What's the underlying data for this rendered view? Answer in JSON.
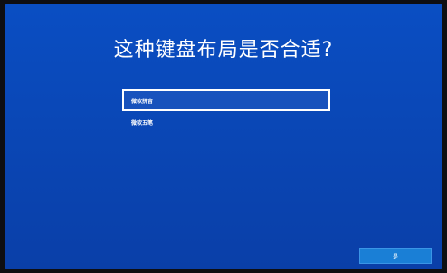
{
  "page": {
    "title": "这种键盘布局是否合适?"
  },
  "layouts": {
    "items": [
      {
        "label": "微软拼音",
        "selected": true
      },
      {
        "label": "微软五笔",
        "selected": false
      }
    ]
  },
  "footer": {
    "next_label": "是"
  },
  "colors": {
    "background": "#0a47b6",
    "accent_button": "#1a7fd6",
    "text": "#ffffff"
  }
}
